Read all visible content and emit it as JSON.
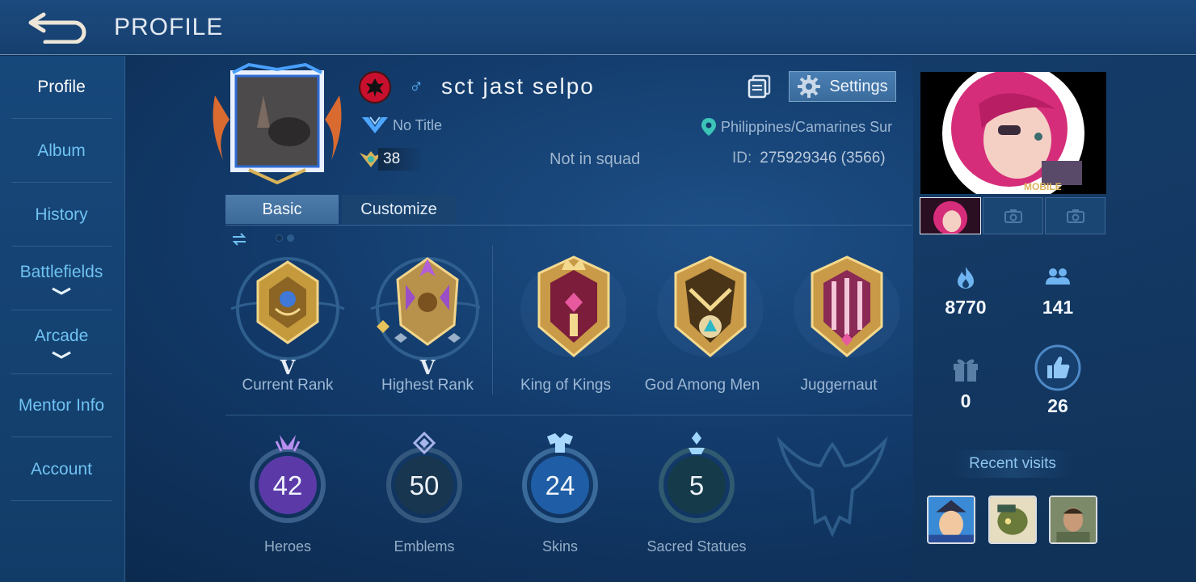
{
  "header": {
    "title": "PROFILE"
  },
  "sidebar": {
    "items": [
      {
        "label": "Profile"
      },
      {
        "label": "Album"
      },
      {
        "label": "History"
      },
      {
        "label": "Battlefields"
      },
      {
        "label": "Arcade"
      },
      {
        "label": "Mentor Info"
      },
      {
        "label": "Account"
      }
    ]
  },
  "profile": {
    "name": "sct jast selpo",
    "gender_icon": "♂",
    "title": "No Title",
    "level": "38",
    "squad": "Not in squad",
    "location": "Philippines/Camarines Sur",
    "id_label": "ID:",
    "id_value": "275929346 (3566)",
    "settings_label": "Settings"
  },
  "tabs": [
    {
      "label": "Basic"
    },
    {
      "label": "Customize"
    }
  ],
  "badges": [
    {
      "label": "Current Rank",
      "tier": "V"
    },
    {
      "label": "Highest Rank",
      "tier": "V"
    },
    {
      "label": "King of Kings"
    },
    {
      "label": "God Among Men"
    },
    {
      "label": "Juggernaut"
    }
  ],
  "stats": [
    {
      "label": "Heroes",
      "value": "42",
      "color": "#8a5ad6"
    },
    {
      "label": "Emblems",
      "value": "50",
      "color": "#c9b680"
    },
    {
      "label": "Skins",
      "value": "24",
      "color": "#3d8fe0"
    },
    {
      "label": "Sacred Statues",
      "value": "5",
      "color": "#3fa38e"
    }
  ],
  "right": {
    "popularity": "8770",
    "followers": "141",
    "gifts": "0",
    "likes": "26",
    "recent_visits": "Recent visits"
  },
  "colors": {
    "accent": "#6fc2f2",
    "gold": "#d9b35a",
    "pink": "#d62d7a"
  }
}
